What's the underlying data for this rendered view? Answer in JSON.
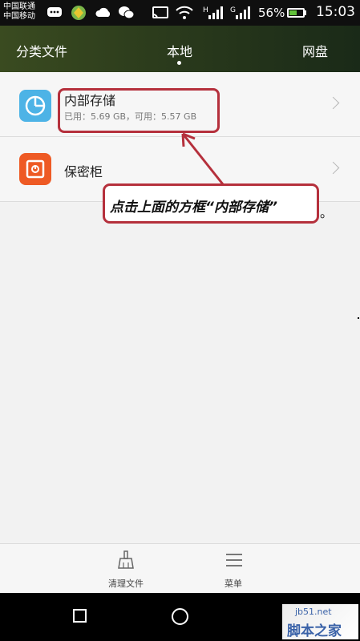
{
  "status_bar": {
    "carrier_primary": "中国联通",
    "carrier_secondary": "中国移动",
    "battery_text": "56%",
    "battery_level": 0.56,
    "time": "15:03",
    "signal_1_label": "H",
    "signal_2_label": "G",
    "icons": [
      "message-icon",
      "app-icon",
      "weather-icon",
      "wechat-icon",
      "cast-icon",
      "wifi-icon",
      "signal-icon",
      "signal-icon",
      "battery-icon"
    ]
  },
  "header": {
    "tabs": [
      {
        "label": "分类文件"
      },
      {
        "label": "本地"
      },
      {
        "label": "网盘"
      }
    ],
    "active_tab": "本地",
    "background_color": "#2f401e"
  },
  "list": {
    "items": [
      {
        "title": "内部存储",
        "subtitle": "已用：5.69 GB，可用：5.57 GB",
        "icon": "pie-chart-icon",
        "icon_color": "#4db3e6"
      },
      {
        "title": "保密柜",
        "icon": "safe-icon",
        "icon_color": "#ee5a24"
      }
    ]
  },
  "annotation": {
    "text": "点击上面的方框“内部存储”",
    "tail": "。",
    "color": "#b5303c"
  },
  "bottom_bar": {
    "items": [
      {
        "label": "清理文件",
        "icon": "broom-icon"
      },
      {
        "label": "菜单",
        "icon": "menu-icon"
      }
    ]
  },
  "nav_bar": {
    "icons": [
      "recent-apps-icon",
      "home-icon"
    ]
  },
  "watermark": {
    "url": "jb51.net",
    "name": "脚本之家"
  }
}
